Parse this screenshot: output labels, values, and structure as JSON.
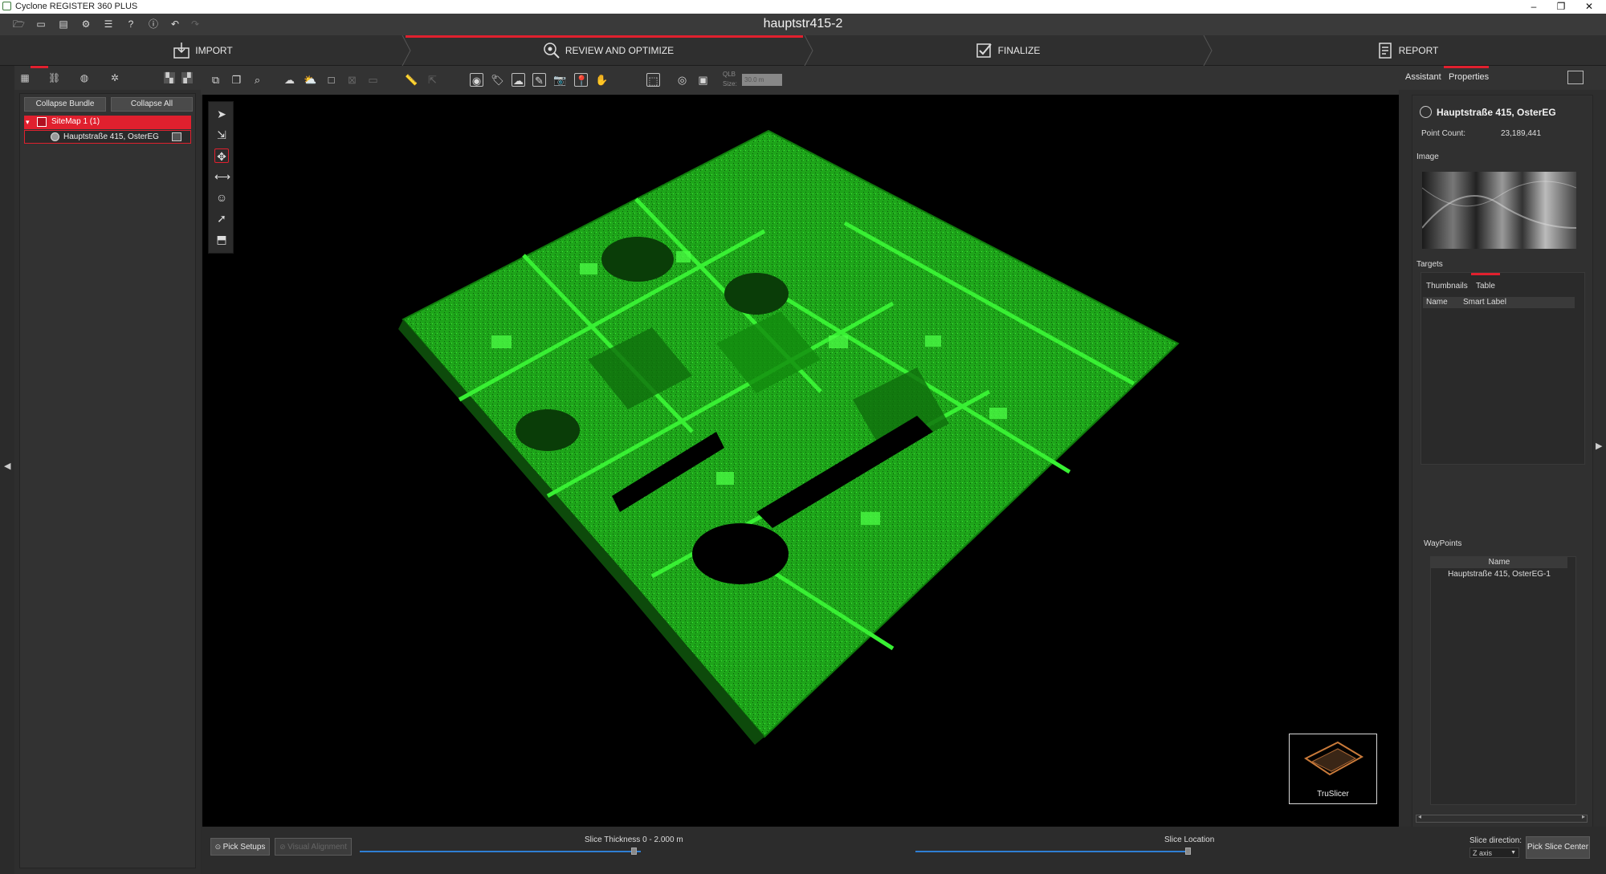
{
  "window": {
    "title": "Cyclone REGISTER 360 PLUS",
    "controls": {
      "minimize": "–",
      "restore": "❐",
      "close": "✕"
    }
  },
  "toolbar": {
    "document_title": "hauptstr415-2",
    "icons": [
      "folder-open-icon",
      "folder-icon",
      "save-icon",
      "gear-icon",
      "database-icon",
      "help-icon",
      "info-icon",
      "undo-icon",
      "redo-icon"
    ]
  },
  "workflow": {
    "steps": [
      {
        "label": "IMPORT",
        "icon": "import-icon"
      },
      {
        "label": "REVIEW AND OPTIMIZE",
        "icon": "review-icon",
        "active": true
      },
      {
        "label": "FINALIZE",
        "icon": "finalize-icon"
      },
      {
        "label": "REPORT",
        "icon": "report-icon"
      }
    ],
    "accent": "#e0202e"
  },
  "left_panel": {
    "collapse_bundle": "Collapse Bundle",
    "collapse_all": "Collapse All",
    "tree": {
      "sitemap": "SiteMap 1 (1)",
      "setup": "Hauptstraße 415, OsterEG"
    }
  },
  "view_toolbar": {
    "qlb_label": "QLB",
    "size_label": "Size:",
    "size_value": "30.0 m"
  },
  "viewport": {
    "point_color": "#22d61d",
    "truslicer_label": "TruSlicer"
  },
  "right_panel": {
    "tabs": {
      "assistant": "Assistant",
      "properties": "Properties"
    },
    "setup_name": "Hauptstraße 415, OsterEG",
    "point_count_label": "Point Count:",
    "point_count_value": "23,189,441",
    "image_label": "Image",
    "targets_label": "Targets",
    "targets_tabs": {
      "thumbnails": "Thumbnails",
      "table": "Table"
    },
    "targets_columns": {
      "name": "Name",
      "smart_label": "Smart Label"
    },
    "waypoints_label": "WayPoints",
    "waypoints_column": "Name",
    "waypoints_rows": [
      "Hauptstraße 415, OsterEG-1"
    ]
  },
  "bottom_bar": {
    "pick_setups": "Pick Setups",
    "visual_alignment": "Visual Alignment",
    "slice_thickness": "Slice Thickness 0 - 2.000 m",
    "slice_location": "Slice Location",
    "slice_direction_label": "Slice direction:",
    "slice_direction_value": "Z axis",
    "pick_slice_center": "Pick Slice Center"
  }
}
